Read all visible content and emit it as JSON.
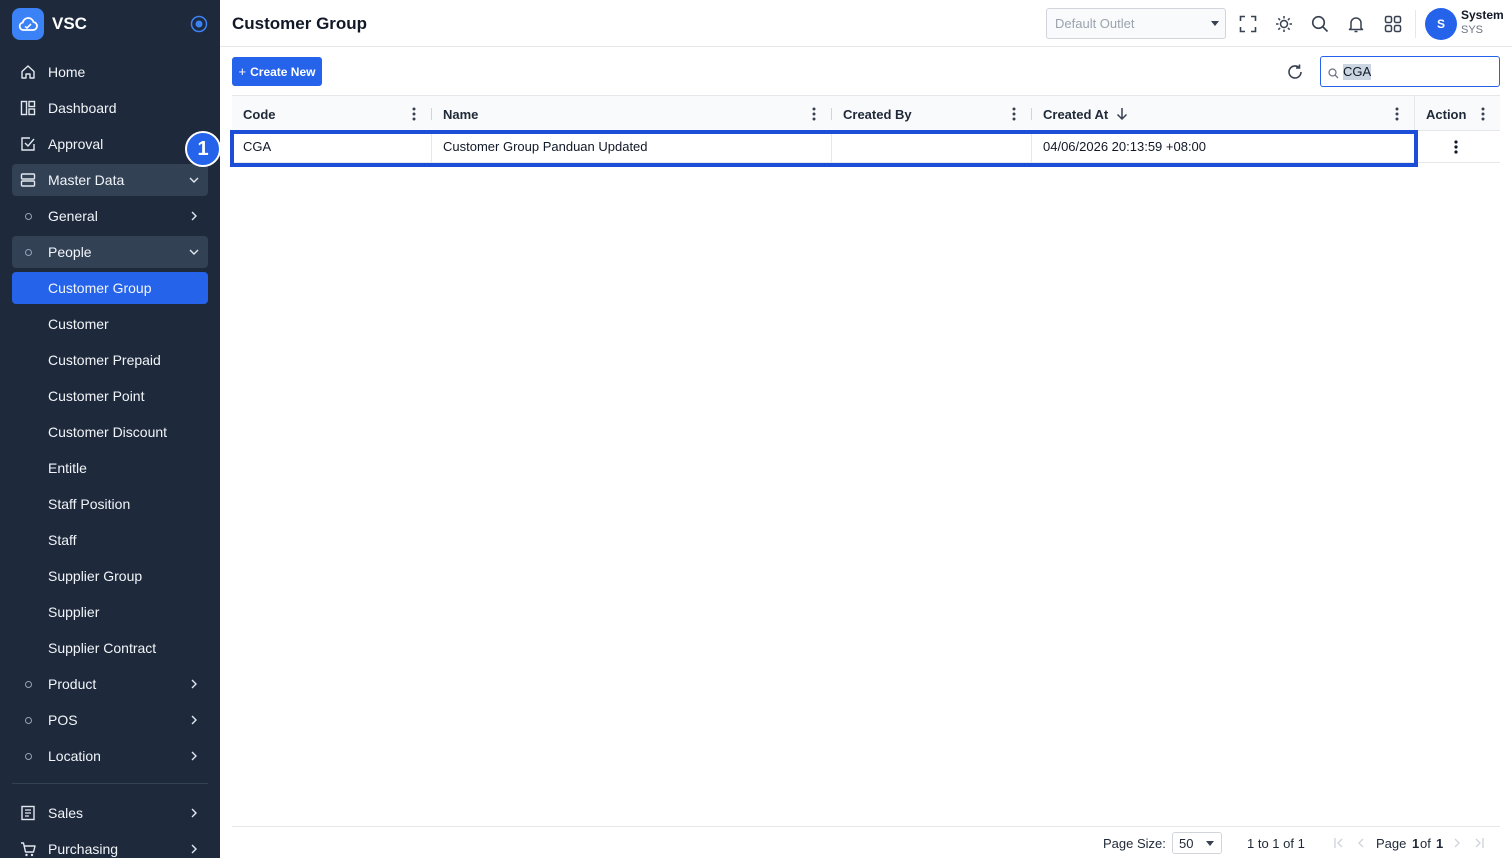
{
  "app": {
    "name": "VSC"
  },
  "sidebar": {
    "items": [
      {
        "label": "Home"
      },
      {
        "label": "Dashboard"
      },
      {
        "label": "Approval"
      },
      {
        "label": "Master Data"
      },
      {
        "label": "General"
      },
      {
        "label": "People"
      },
      {
        "label": "Customer Group"
      },
      {
        "label": "Customer"
      },
      {
        "label": "Customer Prepaid"
      },
      {
        "label": "Customer Point"
      },
      {
        "label": "Customer Discount"
      },
      {
        "label": "Entitle"
      },
      {
        "label": "Staff Position"
      },
      {
        "label": "Staff"
      },
      {
        "label": "Supplier Group"
      },
      {
        "label": "Supplier"
      },
      {
        "label": "Supplier Contract"
      },
      {
        "label": "Product"
      },
      {
        "label": "POS"
      },
      {
        "label": "Location"
      },
      {
        "label": "Sales"
      },
      {
        "label": "Purchasing"
      }
    ]
  },
  "header": {
    "title": "Customer Group",
    "outlet_placeholder": "Default Outlet",
    "user": {
      "initial": "S",
      "name": "System",
      "code": "SYS"
    }
  },
  "toolbar": {
    "create_label": "Create New",
    "search_value": "CGA"
  },
  "grid": {
    "columns": [
      {
        "label": "Code"
      },
      {
        "label": "Name"
      },
      {
        "label": "Created By"
      },
      {
        "label": "Created At"
      },
      {
        "label": "Action"
      }
    ],
    "rows": [
      {
        "code": "CGA",
        "name": "Customer Group Panduan Updated",
        "created_by": "",
        "created_at": "04/06/2026 20:13:59 +08:00"
      }
    ]
  },
  "annotation": {
    "step": "1"
  },
  "footer": {
    "page_size_label": "Page Size:",
    "page_size": "50",
    "range": "1 to 1 of 1",
    "page_word": "Page",
    "current_page": "1",
    "of_word": "of",
    "total_pages": "1"
  },
  "colors": {
    "sidebar_bg": "#1e293b",
    "accent": "#2563eb",
    "highlight_border": "#1d4ed8"
  }
}
